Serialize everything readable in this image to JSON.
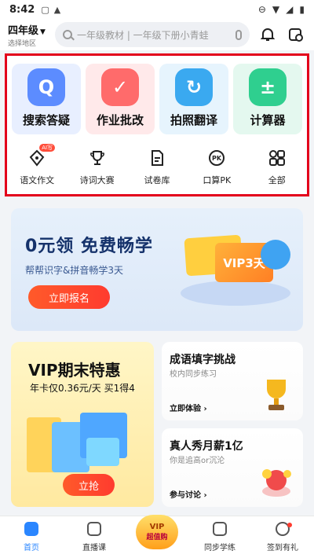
{
  "status_bar": {
    "time": "8:42"
  },
  "header": {
    "grade": "四年级",
    "region": "选择地区",
    "search_placeholder": "一年级教材 | 一年级下册小青蛙"
  },
  "features": {
    "big": [
      {
        "label": "搜索答疑",
        "icon": "search-bubble-icon",
        "color": "#5c8cff",
        "bg": "#e8efff"
      },
      {
        "label": "作业批改",
        "icon": "check-icon",
        "color": "#ff6b6b",
        "bg": "#ffe9ea"
      },
      {
        "label": "拍照翻译",
        "icon": "refresh-icon",
        "color": "#3aa9f0",
        "bg": "#e6f4fd"
      },
      {
        "label": "计算器",
        "icon": "calculator-icon",
        "color": "#2fcf8f",
        "bg": "#e4f8ef"
      }
    ],
    "small": [
      {
        "label": "语文作文",
        "icon": "pen-nib-icon",
        "badge": "AI写"
      },
      {
        "label": "诗词大赛",
        "icon": "trophy-icon"
      },
      {
        "label": "试卷库",
        "icon": "document-icon"
      },
      {
        "label": "口算PK",
        "icon": "pk-icon"
      },
      {
        "label": "全部",
        "icon": "grid-icon"
      }
    ]
  },
  "promo": {
    "title": "0元领 免费畅学",
    "subtitle": "帮帮识字&拼音畅学3天",
    "cta": "立即报名",
    "card_label": "VIP3天"
  },
  "vip_card": {
    "title": "VIP期末特惠",
    "subtitle": "年卡仅0.36元/天 买1得4",
    "cta": "立抢"
  },
  "right_cards": [
    {
      "title": "成语填字挑战",
      "subtitle": "校内同步练习",
      "link": "立即体验 ›"
    },
    {
      "title": "真人秀月薪1亿",
      "subtitle": "你是追高or沉沦",
      "link": "参与讨论 ›"
    }
  ],
  "nav": {
    "items": [
      {
        "label": "首页"
      },
      {
        "label": "直播课"
      },
      {
        "label": "VIP 超值购"
      },
      {
        "label": "同步学练"
      },
      {
        "label": "签到有礼"
      }
    ],
    "vip_line1": "VIP",
    "vip_line2": "超值购",
    "accent": "#2a86ff"
  }
}
